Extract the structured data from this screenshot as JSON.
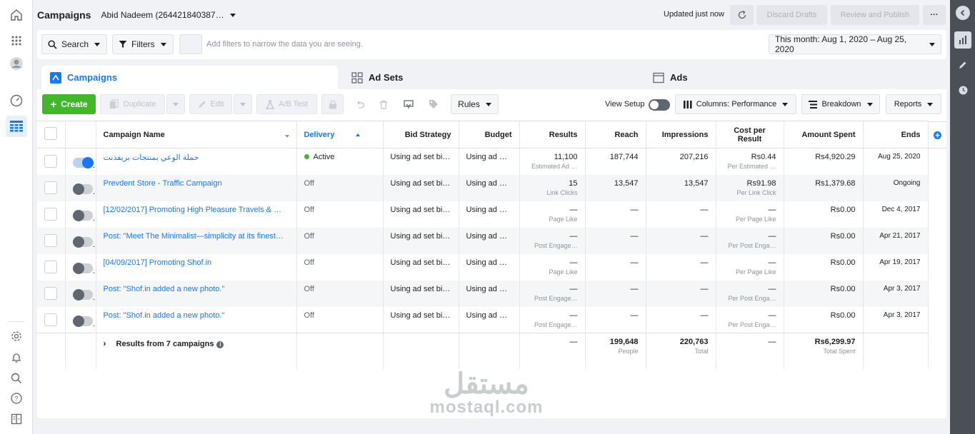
{
  "header": {
    "title": "Campaigns",
    "account": "Abid Nadeem (264421840387…",
    "updated": "Updated just now",
    "discard": "Discard Drafts",
    "review": "Review and Publish",
    "more": "···"
  },
  "filters": {
    "search": "Search",
    "filters": "Filters",
    "hint": "Add filters to narrow the data you are seeing.",
    "date_range": "This month: Aug 1, 2020 – Aug 25, 2020"
  },
  "tabs": {
    "campaigns": "Campaigns",
    "adsets": "Ad Sets",
    "ads": "Ads"
  },
  "toolbar": {
    "create": "Create",
    "duplicate": "Duplicate",
    "edit": "Edit",
    "abtest": "A/B Test",
    "rules": "Rules",
    "view_setup": "View Setup",
    "columns": "Columns: Performance",
    "breakdown": "Breakdown",
    "reports": "Reports"
  },
  "table": {
    "headers": {
      "name": "Campaign Name",
      "delivery": "Delivery",
      "bid": "Bid Strategy",
      "budget": "Budget",
      "results": "Results",
      "reach": "Reach",
      "impressions": "Impressions",
      "cpr": "Cost per Result",
      "spent": "Amount Spent",
      "ends": "Ends"
    },
    "rows": [
      {
        "name": "حملة الوعي بمنتجات بريفدنت",
        "delivery": "Active",
        "bid": "Using ad set bi…",
        "budget": "Using ad …",
        "results": "11,100",
        "results_sub": "Estimated Ad …",
        "reach": "187,744",
        "impressions": "207,216",
        "cpr": "Rs0.44",
        "cpr_sub": "Per Estimated …",
        "spent": "Rs4,920.29",
        "ends": "Aug 25, 2020"
      },
      {
        "name": "Prevdent Store - Traffic Campaign",
        "delivery": "Off",
        "bid": "Using ad set bi…",
        "budget": "Using ad …",
        "results": "15",
        "results_sub": "Link Clicks",
        "reach": "13,547",
        "impressions": "13,547",
        "cpr": "Rs91.98",
        "cpr_sub": "Per Link Click",
        "spent": "Rs1,379.68",
        "ends": "Ongoing"
      },
      {
        "name": "[12/02/2017] Promoting High Pleasure Travels & …",
        "delivery": "Off",
        "bid": "Using ad set bi…",
        "budget": "Using ad …",
        "results": "—",
        "results_sub": "Page Like",
        "reach": "—",
        "impressions": "—",
        "cpr": "—",
        "cpr_sub": "Per Page Like",
        "spent": "Rs0.00",
        "ends": "Dec 4, 2017"
      },
      {
        "name": "Post: \"Meet The Minimalist—simplicity at its finest…",
        "delivery": "Off",
        "bid": "Using ad set bi…",
        "budget": "Using ad …",
        "results": "—",
        "results_sub": "Post Engage…",
        "reach": "—",
        "impressions": "—",
        "cpr": "—",
        "cpr_sub": "Per Post Enga…",
        "spent": "Rs0.00",
        "ends": "Apr 21, 2017"
      },
      {
        "name": "[04/09/2017] Promoting Shof.in",
        "delivery": "Off",
        "bid": "Using ad set bi…",
        "budget": "Using ad …",
        "results": "—",
        "results_sub": "Page Like",
        "reach": "—",
        "impressions": "—",
        "cpr": "—",
        "cpr_sub": "Per Page Like",
        "spent": "Rs0.00",
        "ends": "Apr 19, 2017"
      },
      {
        "name": "Post: \"Shof.in added a new photo.\"",
        "delivery": "Off",
        "bid": "Using ad set bi…",
        "budget": "Using ad …",
        "results": "—",
        "results_sub": "Post Engage…",
        "reach": "—",
        "impressions": "—",
        "cpr": "—",
        "cpr_sub": "Per Post Enga…",
        "spent": "Rs0.00",
        "ends": "Apr 3, 2017"
      },
      {
        "name": "Post: \"Shof.in added a new photo.\"",
        "delivery": "Off",
        "bid": "Using ad set bi…",
        "budget": "Using ad …",
        "results": "—",
        "results_sub": "Post Engage…",
        "reach": "—",
        "impressions": "—",
        "cpr": "—",
        "cpr_sub": "Per Post Enga…",
        "spent": "Rs0.00",
        "ends": "Apr 3, 2017"
      }
    ],
    "total": {
      "label": "Results from 7 campaigns",
      "results": "—",
      "reach": "199,648",
      "reach_sub": "People",
      "impressions": "220,763",
      "impressions_sub": "Total",
      "cpr": "—",
      "spent": "Rs6,299.97",
      "spent_sub": "Total Spent"
    }
  },
  "watermark": {
    "arabic": "مستقل",
    "latin": "mostaql.com"
  },
  "colors": {
    "accent": "#1877f2",
    "create_green": "#42b72a",
    "active_dot": "#42b72a",
    "right_rail": "#4b4f56"
  }
}
